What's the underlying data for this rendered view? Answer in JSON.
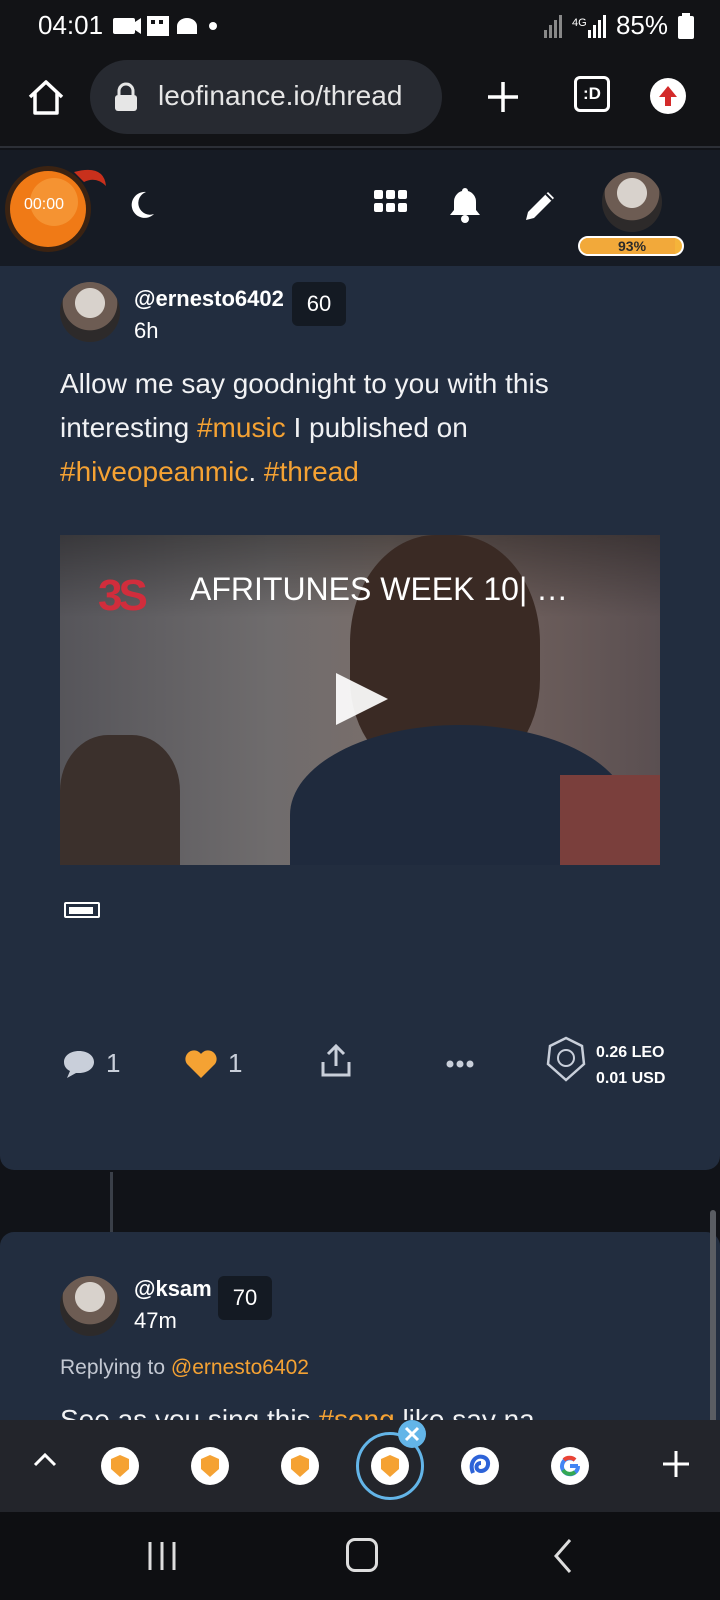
{
  "status_bar": {
    "time": "04:01",
    "battery": "85%",
    "network": "4G"
  },
  "browser": {
    "url": "leofinance.io/thread",
    "tab_count": ":D"
  },
  "header": {
    "timer": "00:00",
    "vote_power": "93%"
  },
  "post": {
    "author": "@ernesto6402",
    "reputation": "60",
    "age": "6h",
    "text": [
      {
        "t": "Allow me say goodnight to you with this interesting ",
        "tag": false
      },
      {
        "t": "#music",
        "tag": true
      },
      {
        "t": " I published on ",
        "tag": false
      },
      {
        "t": "#hiveopeanmic",
        "tag": true
      },
      {
        "t": ". ",
        "tag": false
      },
      {
        "t": "#thread",
        "tag": true
      }
    ],
    "video": {
      "title": "AFRITUNES WEEK 10| …",
      "channel_logo": "3S"
    },
    "comments": "1",
    "likes": "1",
    "payout_leo": "0.26 LEO",
    "payout_usd": "0.01 USD"
  },
  "reply": {
    "author": "@ksam",
    "reputation": "70",
    "age": "47m",
    "replying_label": "Replying to",
    "replying_to": "@ernesto6402",
    "text_start": "See as you sing this",
    "text_tag": "#song",
    "text_end": "like say na"
  },
  "icons": {
    "home": "home-icon",
    "lock": "lock-icon",
    "plus": "plus-icon",
    "moon": "moon-icon",
    "apps": "apps-grid-icon",
    "bell": "bell-icon",
    "pencil": "pencil-icon",
    "comment": "comment-icon",
    "heart": "heart-icon",
    "share": "share-icon",
    "more": "more-icon",
    "leo": "lion-icon"
  },
  "colors": {
    "accent": "#f5a233",
    "card": "#222d3f",
    "header": "#161b24"
  }
}
